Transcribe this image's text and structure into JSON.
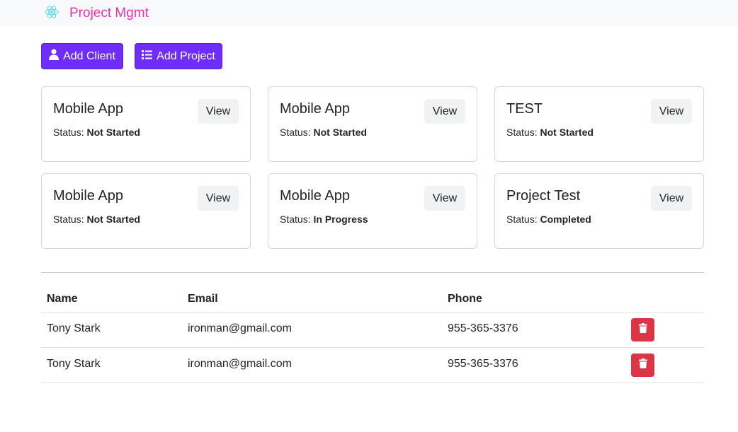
{
  "navbar": {
    "brand_icon": "react-atom-icon",
    "title": "Project Mgmt"
  },
  "actions": {
    "add_client_label": "Add Client",
    "add_client_icon": "user-icon",
    "add_project_label": "Add Project",
    "add_project_icon": "list-icon"
  },
  "colors": {
    "primary": "#6f2dfa",
    "brand": "#e535ab",
    "danger": "#dc3545"
  },
  "projects": [
    {
      "name": "Mobile App",
      "status_label": "Status:",
      "status": "Not Started",
      "view_label": "View"
    },
    {
      "name": "Mobile App",
      "status_label": "Status:",
      "status": "Not Started",
      "view_label": "View"
    },
    {
      "name": "TEST",
      "status_label": "Status:",
      "status": "Not Started",
      "view_label": "View"
    },
    {
      "name": "Mobile App",
      "status_label": "Status:",
      "status": "Not Started",
      "view_label": "View"
    },
    {
      "name": "Mobile App",
      "status_label": "Status:",
      "status": "In Progress",
      "view_label": "View"
    },
    {
      "name": "Project Test",
      "status_label": "Status:",
      "status": "Completed",
      "view_label": "View"
    }
  ],
  "clients": {
    "headers": {
      "name": "Name",
      "email": "Email",
      "phone": "Phone"
    },
    "rows": [
      {
        "name": "Tony Stark",
        "email": "ironman@gmail.com",
        "phone": "955-365-3376",
        "delete_icon": "trash-icon"
      },
      {
        "name": "Tony Stark",
        "email": "ironman@gmail.com",
        "phone": "955-365-3376",
        "delete_icon": "trash-icon"
      }
    ]
  }
}
